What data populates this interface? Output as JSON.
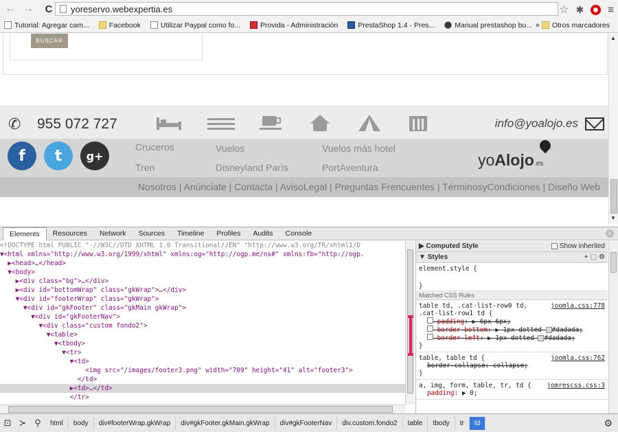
{
  "browser": {
    "url": "yoreservo.webexpertia.es",
    "bookmarks": [
      {
        "label": "Tutorial: Agregar cam...",
        "icon": "page-icon"
      },
      {
        "label": "Facebook",
        "icon": "folder-icon"
      },
      {
        "label": "Utilizar Paypal como fo...",
        "icon": "page-icon"
      },
      {
        "label": "Provida - Administración",
        "icon": "site-icon"
      },
      {
        "label": "PrestaShop 1.4 - Pres...",
        "icon": "prestashop-icon"
      },
      {
        "label": "Manual prestashop bu...",
        "icon": "site-icon"
      }
    ],
    "more": "»",
    "other_bookmarks": "Otros marcadores"
  },
  "page": {
    "buscar_label": "BUSCAR",
    "phone": "955 072 727",
    "email": "info@yoalojo.es",
    "social": {
      "facebook": "f",
      "twitter": "t",
      "googleplus": "g+"
    },
    "links_row1": [
      "Cruceros",
      "Vuelos",
      "Vuelos más hotel"
    ],
    "links_row2": [
      "Tren",
      "Disneyland París",
      "PortAventura"
    ],
    "logo": {
      "part1": "yo",
      "part2": "Alojo",
      "suffix": ".es"
    },
    "footer_nav": "Nosotros | Anúnciate | Contacta | AvisoLegal | Preguntas Frencuentes | TérminosyCondiciones | Diseño Web"
  },
  "devtools": {
    "tabs": [
      "Elements",
      "Resources",
      "Network",
      "Sources",
      "Timeline",
      "Profiles",
      "Audits",
      "Console"
    ],
    "active_tab": "Elements",
    "dom_lines": [
      "<!DOCTYPE html PUBLIC \"-//W3C//DTD XHTML 1.0 Transitional//EN\" \"http://www.w3.org/TR/xhtml1/D",
      "▼<html xmlns=\"http://www.w3.org/1999/xhtml\" xmlns:og=\"http://ogp.me/ns#\" xmlns:fb=\"http://ogp.",
      "  ▶<head>…</head>",
      "  ▼<body>",
      "    ▶<div class=\"bg\">…</div>",
      "    ▶<div id=\"bottomWrap\" class=\"gkWrap\">…</div>",
      "    ▼<div id=\"footerWrap\" class=\"gkWrap\">",
      "      ▼<div id=\"gkFooter\" class=\"gkMain gkWrap\">",
      "        ▼<div id=\"gkFooterNav\">",
      "          ▼<div class=\"custom fondo2\">",
      "            ▼<table>",
      "              ▼<tbody>",
      "                ▼<tr>",
      "                  ▼<td>",
      "                      <img src=\"/images/footer3.png\" width=\"709\" height=\"41\" alt=\"footer3\">",
      "                    </td>",
      "                  ▶<td>…</td>",
      "                  </tr>"
    ],
    "styles": {
      "computed_label": "Computed Style",
      "show_inherited": "Show inherited",
      "styles_label": "Styles",
      "element_style": "element.style {",
      "matched_label": "Matched CSS Rules",
      "rule1": {
        "selector": "table td, .cat-list-row0 td,",
        "selector2": ".cat-list-row1 td {",
        "source": "joomla.css:778",
        "props": [
          {
            "name": "padding",
            "value": "▶ 6px 6px;"
          },
          {
            "name": "border-bottom",
            "value": "▶ 1px dotted ",
            "color": "#dadada;"
          },
          {
            "name": "border-left",
            "value": "▶ 1px dotted ",
            "color": "#dadada;"
          }
        ]
      },
      "rule2": {
        "selector": "table, table td {",
        "source": "joomla.css:762",
        "prop": "border-collapse: collapse;"
      },
      "rule3": {
        "selector": "a, img, form, table, tr, td {",
        "source": "jomrescss.css:3",
        "prop_name": "padding",
        "prop_value": "▶ 0;"
      }
    },
    "breadcrumbs": [
      "html",
      "body",
      "div#footerWrap.gkWrap",
      "div#gkFooter.gkMain.gkWrap",
      "div#gkFooterNav",
      "div.custom.fondo2",
      "table",
      "tbody",
      "tr",
      "td"
    ],
    "active_breadcrumb": "td"
  }
}
